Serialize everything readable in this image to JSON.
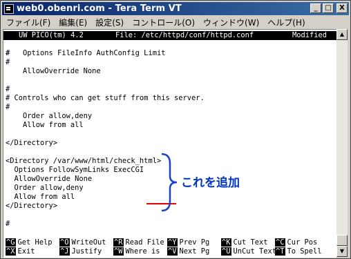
{
  "window": {
    "title": "web0.obenri.com - Tera Term VT",
    "minimize_glyph": "_",
    "maximize_glyph": "□",
    "close_glyph": "X"
  },
  "menu": [
    "ファイル(F)",
    "編集(E)",
    "設定(S)",
    "コントロール(O)",
    "ウィンドウ(W)",
    "ヘルプ(H)"
  ],
  "status_bar": {
    "editor": "UW PICO(tm) 4.2",
    "file": "File: /etc/httpd/conf/httpd.conf",
    "state": "Modified"
  },
  "editor_lines": [
    "#",
    "#   Options FileInfo AuthConfig Limit",
    "#",
    "    AllowOverride None",
    "",
    "#",
    "# Controls who can get stuff from this server.",
    "#",
    "",
    "    Order allow,deny",
    "    Allow from all",
    "",
    "</Directory>",
    "",
    "<Directory /var/www/html/check_html>",
    "  Options FollowSymLinks ExecCGI",
    "  AllowOverride None",
    "  Order allow,deny",
    "  Allow from all",
    "</Directory>",
    "",
    "",
    "#"
  ],
  "annotation": {
    "text": "これを追加",
    "color": "#0033cc"
  },
  "shortcuts": [
    [
      {
        "key": "^G",
        "label": "Get Help"
      },
      {
        "key": "^O",
        "label": "WriteOut"
      },
      {
        "key": "^R",
        "label": "Read File"
      },
      {
        "key": "^Y",
        "label": "Prev Pg"
      },
      {
        "key": "^K",
        "label": "Cut Text"
      },
      {
        "key": "^C",
        "label": "Cur Pos"
      }
    ],
    [
      {
        "key": "^X",
        "label": "Exit"
      },
      {
        "key": "^J",
        "label": "Justify"
      },
      {
        "key": "^W",
        "label": "Where is"
      },
      {
        "key": "^V",
        "label": "Next Pg"
      },
      {
        "key": "^U",
        "label": "UnCut Text"
      },
      {
        "key": "^T",
        "label": "To Spell"
      }
    ]
  ],
  "scrollbar": {
    "up_glyph": "▲",
    "down_glyph": "▼"
  }
}
